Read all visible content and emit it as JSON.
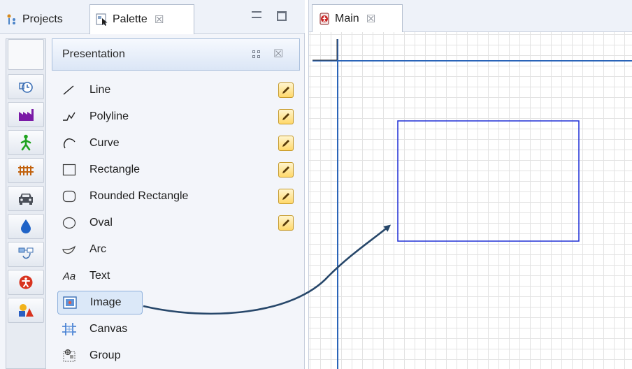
{
  "left_tabs": {
    "projects": {
      "label": "Projects",
      "icon": "projects-icon"
    },
    "palette": {
      "label": "Palette",
      "icon": "palette-icon"
    }
  },
  "window_controls": {
    "minimize_icon": "minimize-icon",
    "maximize_icon": "maximize-icon",
    "close_glyph": "☒"
  },
  "category_strip": {
    "items": [
      {
        "icon": "blank-category-icon"
      },
      {
        "icon": "clock-statechart-icon"
      },
      {
        "icon": "factory-icon"
      },
      {
        "icon": "pedestrian-icon"
      },
      {
        "icon": "rail-track-icon"
      },
      {
        "icon": "car-icon"
      },
      {
        "icon": "fluid-drop-icon"
      },
      {
        "icon": "connectivity-icon"
      },
      {
        "icon": "accessibility-icon"
      },
      {
        "icon": "shapes-icon"
      }
    ]
  },
  "palette": {
    "title": "Presentation",
    "items": [
      {
        "label": "Line",
        "icon": "line-icon",
        "has_pencil": true
      },
      {
        "label": "Polyline",
        "icon": "polyline-icon",
        "has_pencil": true
      },
      {
        "label": "Curve",
        "icon": "curve-icon",
        "has_pencil": true
      },
      {
        "label": "Rectangle",
        "icon": "rectangle-icon",
        "has_pencil": true
      },
      {
        "label": "Rounded Rectangle",
        "icon": "rounded-rectangle-icon",
        "has_pencil": true
      },
      {
        "label": "Oval",
        "icon": "oval-icon",
        "has_pencil": true
      },
      {
        "label": "Arc",
        "icon": "arc-icon",
        "has_pencil": false
      },
      {
        "label": "Text",
        "icon": "text-icon",
        "icon_text": "Aa",
        "has_pencil": false
      },
      {
        "label": "Image",
        "icon": "image-icon",
        "has_pencil": false,
        "selected": true
      },
      {
        "label": "Canvas",
        "icon": "canvas-icon",
        "has_pencil": false
      },
      {
        "label": "Group",
        "icon": "group-icon",
        "has_pencil": false
      }
    ]
  },
  "editor": {
    "tab": {
      "label": "Main",
      "icon": "agent-main-icon"
    }
  },
  "colors": {
    "accent_blue": "#1f2fd6",
    "arrow": "#27476a",
    "axis": "#2a64b8",
    "pencil": "#ffd86a"
  }
}
